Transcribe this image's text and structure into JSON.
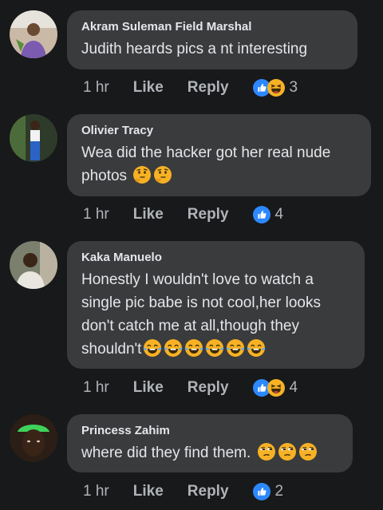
{
  "comments": [
    {
      "author": "Akram Suleman Field Marshal",
      "text": "Judith heards pics a nt interesting",
      "emojis": [],
      "time": "1 hr",
      "like": "Like",
      "reply": "Reply",
      "reactions": [
        "like-icon",
        "laugh-icon"
      ],
      "count": "3"
    },
    {
      "author": "Olivier Tracy",
      "text": "Wea did the hacker got her real nude photos",
      "emojis": [
        "thinking-emoji",
        "thinking-emoji"
      ],
      "time": "1 hr",
      "like": "Like",
      "reply": "Reply",
      "reactions": [
        "like-icon"
      ],
      "count": "4"
    },
    {
      "author": "Kaka Manuelo",
      "text": "Honestly I wouldn't love to watch a single pic babe is not cool,her looks don't catch me at all,though they shouldn't",
      "emojis": [
        "tears-of-joy-emoji",
        "tears-of-joy-emoji",
        "tears-of-joy-emoji",
        "tears-of-joy-emoji",
        "tears-of-joy-emoji",
        "tears-of-joy-emoji"
      ],
      "time": "1 hr",
      "like": "Like",
      "reply": "Reply",
      "reactions": [
        "like-icon",
        "laugh-icon"
      ],
      "count": "4"
    },
    {
      "author": "Princess Zahim",
      "text": "where did they find them.",
      "emojis": [
        "unamused-emoji",
        "unamused-emoji",
        "unamused-emoji"
      ],
      "time": "1 hr",
      "like": "Like",
      "reply": "Reply",
      "reactions": [
        "like-icon"
      ],
      "count": "2"
    }
  ],
  "colors": {
    "background": "#18191a",
    "bubble": "#3a3b3c",
    "like_blue": "#2d88ff",
    "emoji_yellow": "#f7b125"
  }
}
